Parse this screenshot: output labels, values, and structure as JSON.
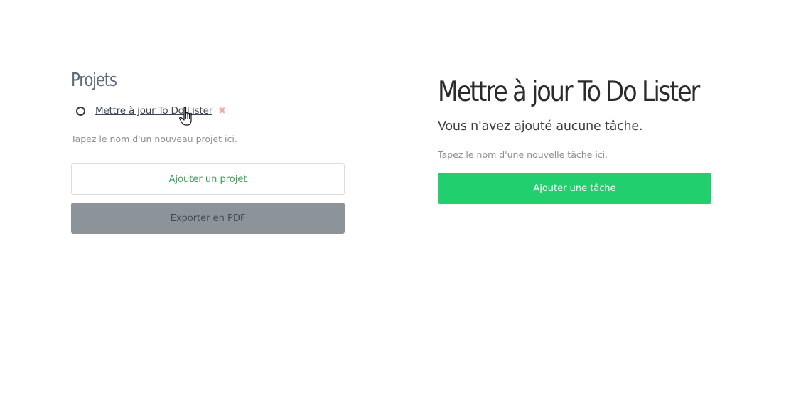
{
  "projects": {
    "heading": "Projets",
    "items": [
      {
        "label": "Mettre à jour To Do Lister",
        "delete_symbol": "✖"
      }
    ],
    "input_hint": "Tapez le nom d'un nouveau projet ici.",
    "add_button_label": "Ajouter un projet",
    "export_button_label": "Exporter en PDF"
  },
  "tasks": {
    "title": "Mettre à jour To Do Lister",
    "empty_message": "Vous n'avez ajouté aucune tâche.",
    "input_hint": "Tapez le nom d'une nouvelle tâche ici.",
    "add_button_label": "Ajouter une tâche"
  },
  "icons": {
    "project_status": "radio-circle-icon",
    "delete": "close-x-icon",
    "cursor": "hand-pointer-icon"
  },
  "colors": {
    "accent_green": "#21cf6f",
    "outline_text_green": "#2fa55a",
    "grey_button": "#8c9399",
    "delete_pink": "#f4a6a6"
  }
}
